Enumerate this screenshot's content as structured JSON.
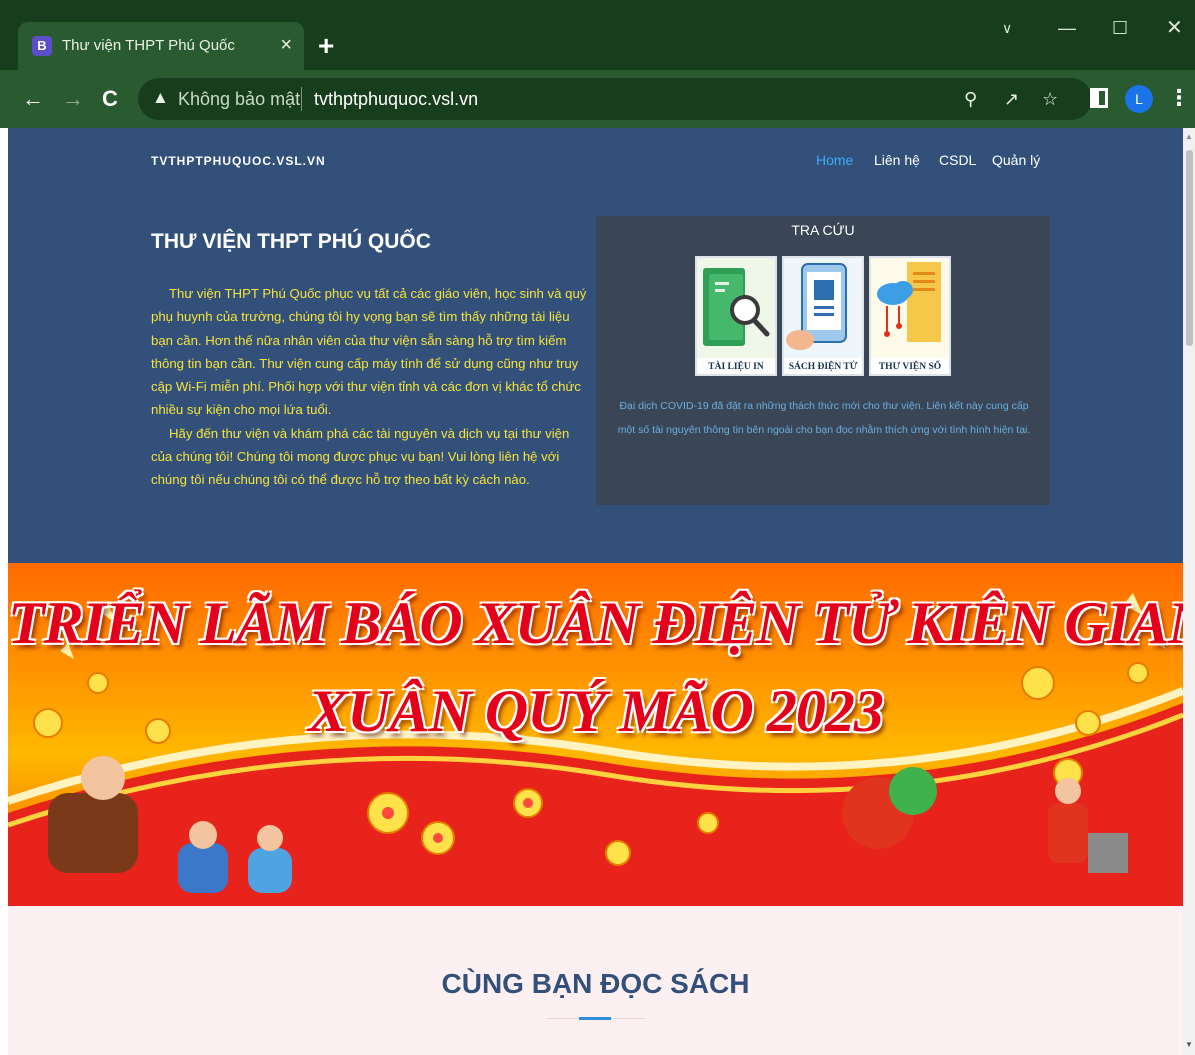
{
  "browser": {
    "tab_title": "Thư viện THPT Phú Quốc",
    "tab_favicon_letter": "B",
    "tab_close": "×",
    "new_tab": "+",
    "security_label": "Không bảo mật",
    "url": "tvthptphuquoc.vsl.vn",
    "profile_initial": "L",
    "icons": [
      "favicon-icon",
      "close-icon",
      "plus-icon",
      "back-icon",
      "forward-icon",
      "reload-icon",
      "warning-icon",
      "zoom-icon",
      "share-icon",
      "star-icon",
      "side-panel-icon",
      "menu-icon"
    ]
  },
  "site": {
    "brand": "TVTHPTPHUQUOC.VSL.VN",
    "nav": {
      "home": "Home",
      "contact": "Liên hệ",
      "csdl": "CSDL",
      "admin": "Quản lý"
    },
    "hero": {
      "title": "THƯ VIỆN THPT PHÚ QUỐC",
      "paragraph1": "Thư viện THPT Phú Quốc phục vụ tất cả các giáo viên, học sinh và quý phụ huynh của trường, chúng tôi hy vọng bạn sẽ tìm thấy những tài liệu bạn cần. Hơn thế nữa nhân viên của thư viện sẵn sàng hỗ trợ tìm kiếm thông tin bạn cần. Thư viện cung cấp máy tính để sử dụng cũng như truy cập Wi-Fi miễn phí. Phối hợp với thư viện tỉnh và các đơn vị khác tổ chức nhiều sự kiện cho mọi lứa tuổi.",
      "paragraph2": "Hãy đến thư viện và khám phá các tài nguyên và dịch vụ tại thư viện của chúng tôi! Chúng tôi mong được phục vụ bạn! Vui lòng liên hệ với chúng tôi nếu chúng tôi có thể được hỗ trợ theo bất kỳ cách nào."
    },
    "lookup": {
      "title": "TRA CỨU",
      "cards": [
        "TÀI LIỆU IN",
        "SÁCH ĐIỆN TỬ",
        "THƯ VIỆN SỐ"
      ],
      "note": "Đại dịch COVID-19 đã đặt ra những thách thức mới cho thư viện. Liên kết này cung cấp một số tài nguyên thông tin bên ngoài cho bạn đọc nhằm thích ứng với tình hình hiện tại."
    },
    "banner": {
      "line1": "TRIỂN LÃM BÁO XUÂN ĐIỆN TỬ KIÊN GIANG",
      "line2": "XUÂN QUÝ MÃO 2023"
    },
    "section": {
      "title": "CÙNG BẠN ĐỌC SÁCH"
    }
  },
  "colors": {
    "browser_frame": "#173d1c",
    "browser_toolbar": "#2a5a2f",
    "hero_bg": "#33507b",
    "hero_text": "#f5e43a",
    "nav_active": "#3fa9f5",
    "lookup_bg": "#3a4656",
    "section_bg": "#fdf0f3",
    "banner_title": "#e4001b"
  }
}
